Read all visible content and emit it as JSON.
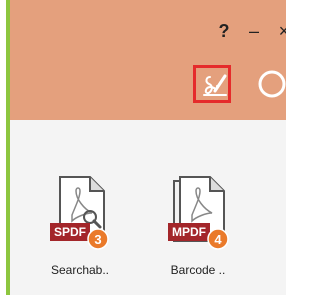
{
  "window": {
    "controls": {
      "help": "?",
      "minimize": "–",
      "close": "×"
    }
  },
  "toolbar": {
    "sign_icon": "signature-icon",
    "search_icon": "search-icon",
    "accent_color": "#e52b2b"
  },
  "tools": [
    {
      "badge_text": "SPDF",
      "badge_number": "3",
      "label": "Searchab.."
    },
    {
      "badge_text": "MPDF",
      "badge_number": "4",
      "label": "Barcode .."
    }
  ],
  "colors": {
    "header_bg": "#e4a07d",
    "content_bg": "#f4f4f4",
    "badge_red": "#a3262a",
    "badge_orange": "#ea7a2a",
    "side_border": "#8dc63f"
  }
}
